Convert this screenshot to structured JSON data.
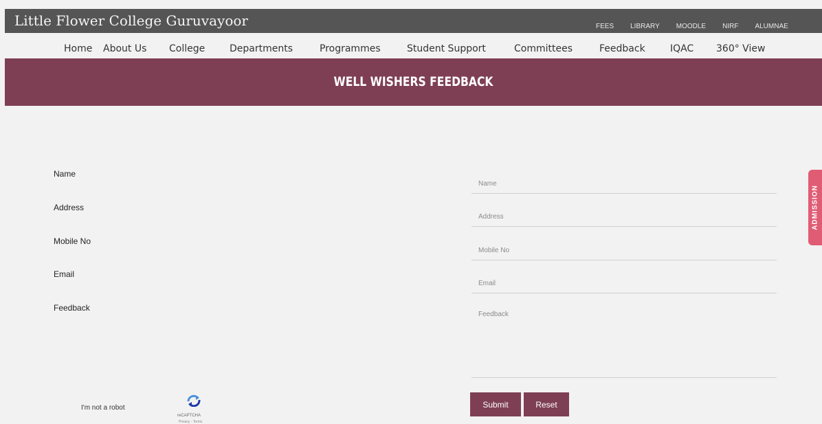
{
  "header": {
    "site_title": "Little Flower College Guruvayoor",
    "quick_links": [
      "FEES",
      "LIBRARY",
      "MOODLE",
      "NIRF",
      "ALUMNAE"
    ]
  },
  "nav": {
    "items": [
      "Home",
      "About Us",
      "College",
      "Departments",
      "Programmes",
      "Student Support",
      "Committees",
      "Feedback",
      "IQAC",
      "360° View"
    ]
  },
  "banner": {
    "title": "WELL WISHERS FEEDBACK"
  },
  "form": {
    "labels": {
      "name": "Name",
      "address": "Address",
      "mobile": "Mobile No",
      "email": "Email",
      "feedback": "Feedback"
    },
    "placeholders": {
      "name": "Name",
      "address": "Address",
      "mobile": "Mobile No",
      "email": "Email",
      "feedback": "Feedback"
    },
    "submit_label": "Submit",
    "reset_label": "Reset"
  },
  "captcha": {
    "label": "I'm not a robot",
    "brand": "reCAPTCHA",
    "links": "Privacy - Terms",
    "icon": "recaptcha-icon"
  },
  "side_tab": {
    "label": "ADMISSION"
  },
  "colors": {
    "topbar": "#555555",
    "accent": "#7e3f54",
    "admission": "#e05c74",
    "background": "#f2f2f2"
  }
}
